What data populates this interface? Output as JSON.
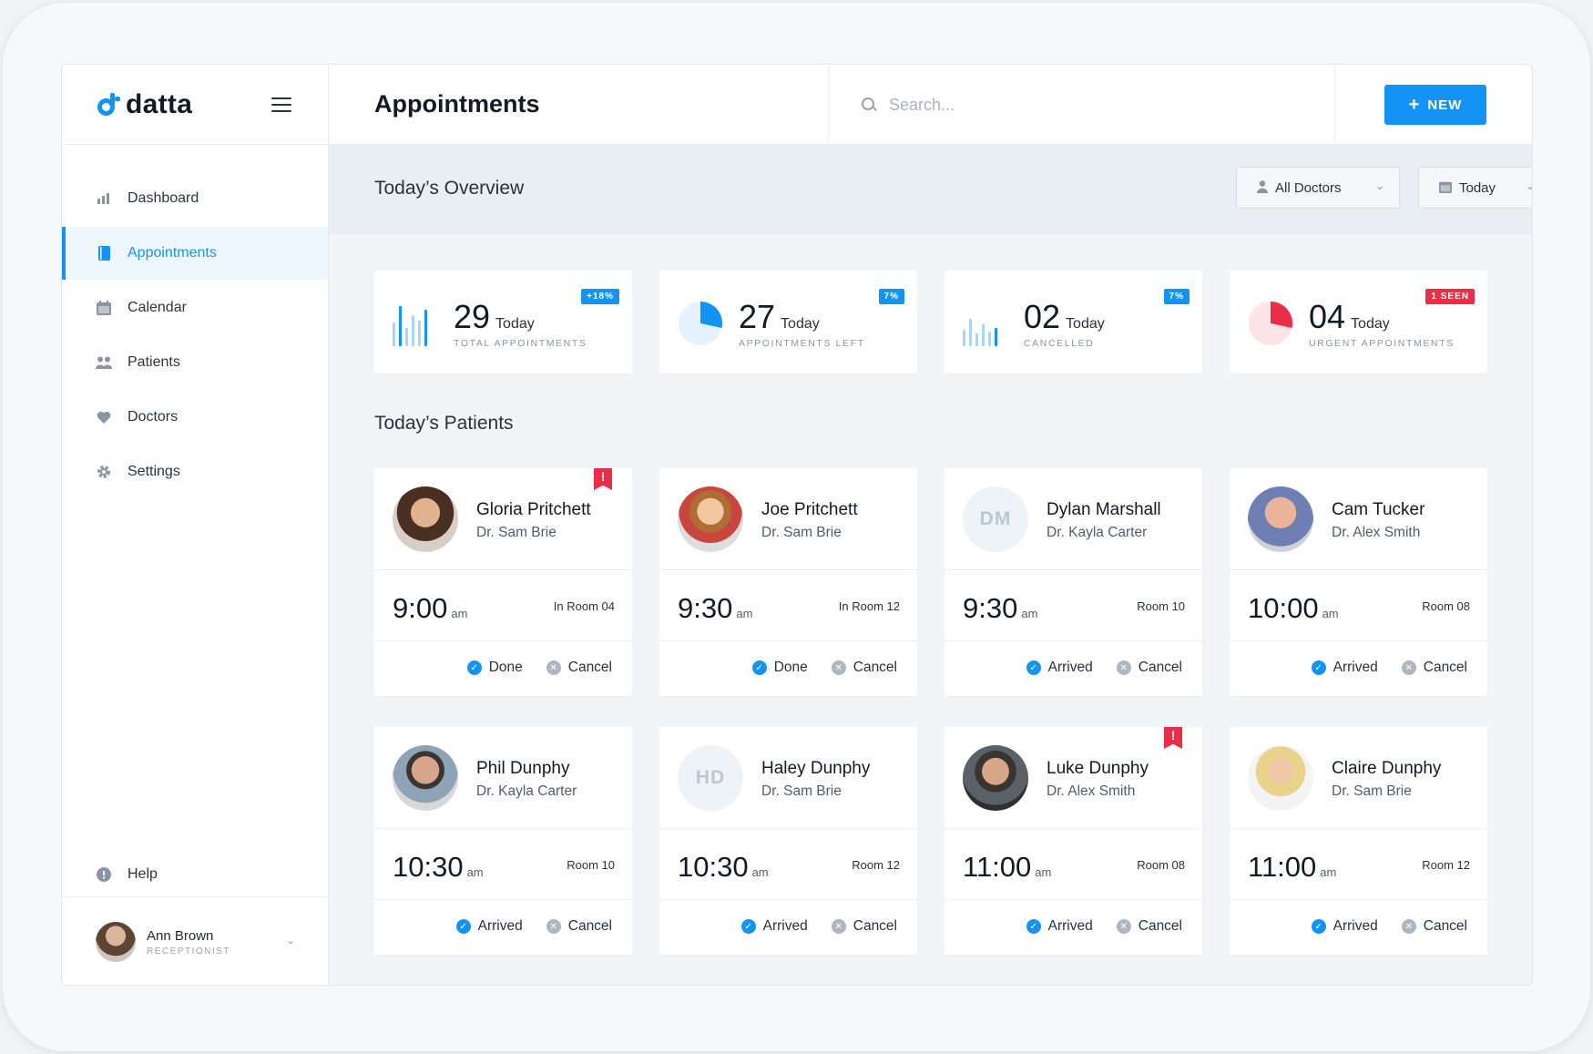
{
  "brand": {
    "name": "datta"
  },
  "sidebar": {
    "items": [
      {
        "label": "Dashboard",
        "icon": "bar-chart-icon",
        "active": false
      },
      {
        "label": "Appointments",
        "icon": "book-icon",
        "active": true
      },
      {
        "label": "Calendar",
        "icon": "calendar-icon",
        "active": false
      },
      {
        "label": "Patients",
        "icon": "users-icon",
        "active": false
      },
      {
        "label": "Doctors",
        "icon": "heart-icon",
        "active": false
      },
      {
        "label": "Settings",
        "icon": "gear-icon",
        "active": false
      }
    ],
    "help": {
      "label": "Help",
      "icon": "info-icon"
    },
    "profile": {
      "name": "Ann Brown",
      "role": "RECEPTIONIST"
    }
  },
  "header": {
    "title": "Appointments",
    "search_placeholder": "Search...",
    "new_button": "NEW"
  },
  "overview": {
    "title": "Today’s Overview",
    "doctor_filter": "All Doctors",
    "date_filter": "Today"
  },
  "stats": [
    {
      "value": "29",
      "suffix": "Today",
      "label": "TOTAL APPOINTMENTS",
      "badge": "+18%",
      "badge_color": "#1593f5"
    },
    {
      "value": "27",
      "suffix": "Today",
      "label": "APPOINTMENTS LEFT",
      "badge": "7%",
      "badge_color": "#1593f5"
    },
    {
      "value": "02",
      "suffix": "Today",
      "label": "CANCELLED",
      "badge": "7%",
      "badge_color": "#1593f5"
    },
    {
      "value": "04",
      "suffix": "Today",
      "label": "URGENT APPOINTMENTS",
      "badge": "1 SEEN",
      "badge_color": "#ea2e49"
    }
  ],
  "patients_title": "Today’s Patients",
  "patients": [
    {
      "name": "Gloria Pritchett",
      "doctor": "Dr. Sam Brie",
      "time": "9:00",
      "ampm": "am",
      "room": "In Room 04",
      "status": "Done",
      "cancel": "Cancel",
      "urgent": true,
      "initials": ""
    },
    {
      "name": "Joe Pritchett",
      "doctor": "Dr. Sam Brie",
      "time": "9:30",
      "ampm": "am",
      "room": "In Room 12",
      "status": "Done",
      "cancel": "Cancel",
      "urgent": false,
      "initials": ""
    },
    {
      "name": "Dylan Marshall",
      "doctor": "Dr. Kayla Carter",
      "time": "9:30",
      "ampm": "am",
      "room": "Room 10",
      "status": "Arrived",
      "cancel": "Cancel",
      "urgent": false,
      "initials": "DM"
    },
    {
      "name": "Cam Tucker",
      "doctor": "Dr. Alex Smith",
      "time": "10:00",
      "ampm": "am",
      "room": "Room 08",
      "status": "Arrived",
      "cancel": "Cancel",
      "urgent": false,
      "initials": ""
    },
    {
      "name": "Phil Dunphy",
      "doctor": "Dr. Kayla Carter",
      "time": "10:30",
      "ampm": "am",
      "room": "Room 10",
      "status": "Arrived",
      "cancel": "Cancel",
      "urgent": false,
      "initials": ""
    },
    {
      "name": "Haley Dunphy",
      "doctor": "Dr. Sam Brie",
      "time": "10:30",
      "ampm": "am",
      "room": "Room 12",
      "status": "Arrived",
      "cancel": "Cancel",
      "urgent": false,
      "initials": "HD"
    },
    {
      "name": "Luke Dunphy",
      "doctor": "Dr. Alex Smith",
      "time": "11:00",
      "ampm": "am",
      "room": "Room 08",
      "status": "Arrived",
      "cancel": "Cancel",
      "urgent": true,
      "initials": ""
    },
    {
      "name": "Claire Dunphy",
      "doctor": "Dr. Sam Brie",
      "time": "11:00",
      "ampm": "am",
      "room": "Room 12",
      "status": "Arrived",
      "cancel": "Cancel",
      "urgent": false,
      "initials": ""
    }
  ],
  "colors": {
    "accent": "#1593f5",
    "urgent": "#ea2e49"
  }
}
